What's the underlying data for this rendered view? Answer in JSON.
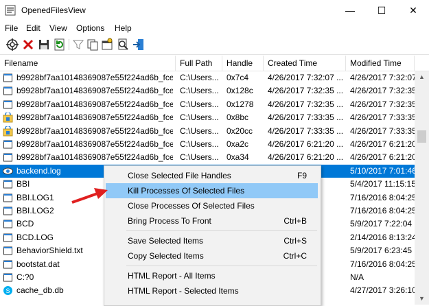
{
  "window": {
    "title": "OpenedFilesView",
    "minimize": "—",
    "maximize": "☐",
    "close": "✕"
  },
  "menu": [
    "File",
    "Edit",
    "View",
    "Options",
    "Help"
  ],
  "toolbar": [
    "target-icon",
    "delete-x-icon",
    "save-icon",
    "refresh-icon",
    "filter-icon",
    "copy-icon",
    "properties-icon",
    "html-report-icon",
    "exit-icon"
  ],
  "columns": [
    "Filename",
    "Full Path",
    "Handle",
    "Created Time",
    "Modified Time"
  ],
  "rows": [
    {
      "icon": "file",
      "name": "b9928bf7aa10148369087e55f224ad6b_fce8...",
      "path": "C:\\Users...",
      "handle": "0x7c4",
      "created": "4/26/2017 7:32:07 ...",
      "modified": "4/26/2017 7:32:07"
    },
    {
      "icon": "file",
      "name": "b9928bf7aa10148369087e55f224ad6b_fce8...",
      "path": "C:\\Users...",
      "handle": "0x128c",
      "created": "4/26/2017 7:32:35 ...",
      "modified": "4/26/2017 7:32:35"
    },
    {
      "icon": "file",
      "name": "b9928bf7aa10148369087e55f224ad6b_fce8...",
      "path": "C:\\Users...",
      "handle": "0x1278",
      "created": "4/26/2017 7:32:35 ...",
      "modified": "4/26/2017 7:32:35"
    },
    {
      "icon": "lock",
      "name": "b9928bf7aa10148369087e55f224ad6b_fce8...",
      "path": "C:\\Users...",
      "handle": "0x8bc",
      "created": "4/26/2017 7:33:35 ...",
      "modified": "4/26/2017 7:33:35"
    },
    {
      "icon": "lock",
      "name": "b9928bf7aa10148369087e55f224ad6b_fce8...",
      "path": "C:\\Users...",
      "handle": "0x20cc",
      "created": "4/26/2017 7:33:35 ...",
      "modified": "4/26/2017 7:33:35"
    },
    {
      "icon": "file",
      "name": "b9928bf7aa10148369087e55f224ad6b_fce8...",
      "path": "C:\\Users...",
      "handle": "0xa2c",
      "created": "4/26/2017 6:21:20 ...",
      "modified": "4/26/2017 6:21:20"
    },
    {
      "icon": "file",
      "name": "b9928bf7aa10148369087e55f224ad6b_fce8...",
      "path": "C:\\Users...",
      "handle": "0xa34",
      "created": "4/26/2017 6:21:20 ...",
      "modified": "4/26/2017 6:21:20"
    },
    {
      "icon": "eye",
      "name": "backend.log",
      "path": "",
      "handle": "",
      "created": "28 PM",
      "modified": "5/10/2017 7:01:46",
      "selected": true
    },
    {
      "icon": "file",
      "name": "BBI",
      "path": "",
      "handle": "",
      "created": "",
      "modified": "5/4/2017 11:15:15"
    },
    {
      "icon": "file",
      "name": "BBI.LOG1",
      "path": "",
      "handle": "",
      "created": "",
      "modified": "7/16/2016 8:04:25"
    },
    {
      "icon": "file",
      "name": "BBI.LOG2",
      "path": "",
      "handle": "",
      "created": "",
      "modified": "7/16/2016 8:04:25"
    },
    {
      "icon": "file",
      "name": "BCD",
      "path": "",
      "handle": "",
      "created": "9:45...",
      "modified": "5/9/2017 7:22:04 P"
    },
    {
      "icon": "file",
      "name": "BCD.LOG",
      "path": "",
      "handle": "",
      "created": "9:45...",
      "modified": "2/14/2016 8:13:24"
    },
    {
      "icon": "file",
      "name": "BehaviorShield.txt",
      "path": "",
      "handle": "",
      "created": "3:45...",
      "modified": "5/9/2017 6:23:45 P"
    },
    {
      "icon": "file",
      "name": "bootstat.dat",
      "path": "",
      "handle": "",
      "created": "9:45...",
      "modified": "7/16/2016 8:04:25"
    },
    {
      "icon": "file",
      "name": "C:?0",
      "path": "",
      "handle": "",
      "created": "",
      "modified": "N/A"
    },
    {
      "icon": "skype",
      "name": "cache_db.db",
      "path": "",
      "handle": "",
      "created": "8:10...",
      "modified": "4/27/2017 3:26:10"
    }
  ],
  "context_menu": [
    {
      "label": "Close Selected File Handles",
      "key": "F9"
    },
    {
      "label": "Kill Processes Of Selected Files",
      "key": "",
      "highlight": true
    },
    {
      "label": "Close Processes Of Selected Files",
      "key": ""
    },
    {
      "label": "Bring Process To Front",
      "key": "Ctrl+B"
    },
    {
      "label": "Save Selected Items",
      "key": "Ctrl+S"
    },
    {
      "label": "Copy Selected Items",
      "key": "Ctrl+C"
    },
    {
      "label": "HTML Report - All Items",
      "key": ""
    },
    {
      "label": "HTML Report - Selected Items",
      "key": ""
    }
  ],
  "colors": {
    "selection": "#0078d7",
    "menu_highlight": "#91c9f7",
    "arrow": "#e02020"
  }
}
